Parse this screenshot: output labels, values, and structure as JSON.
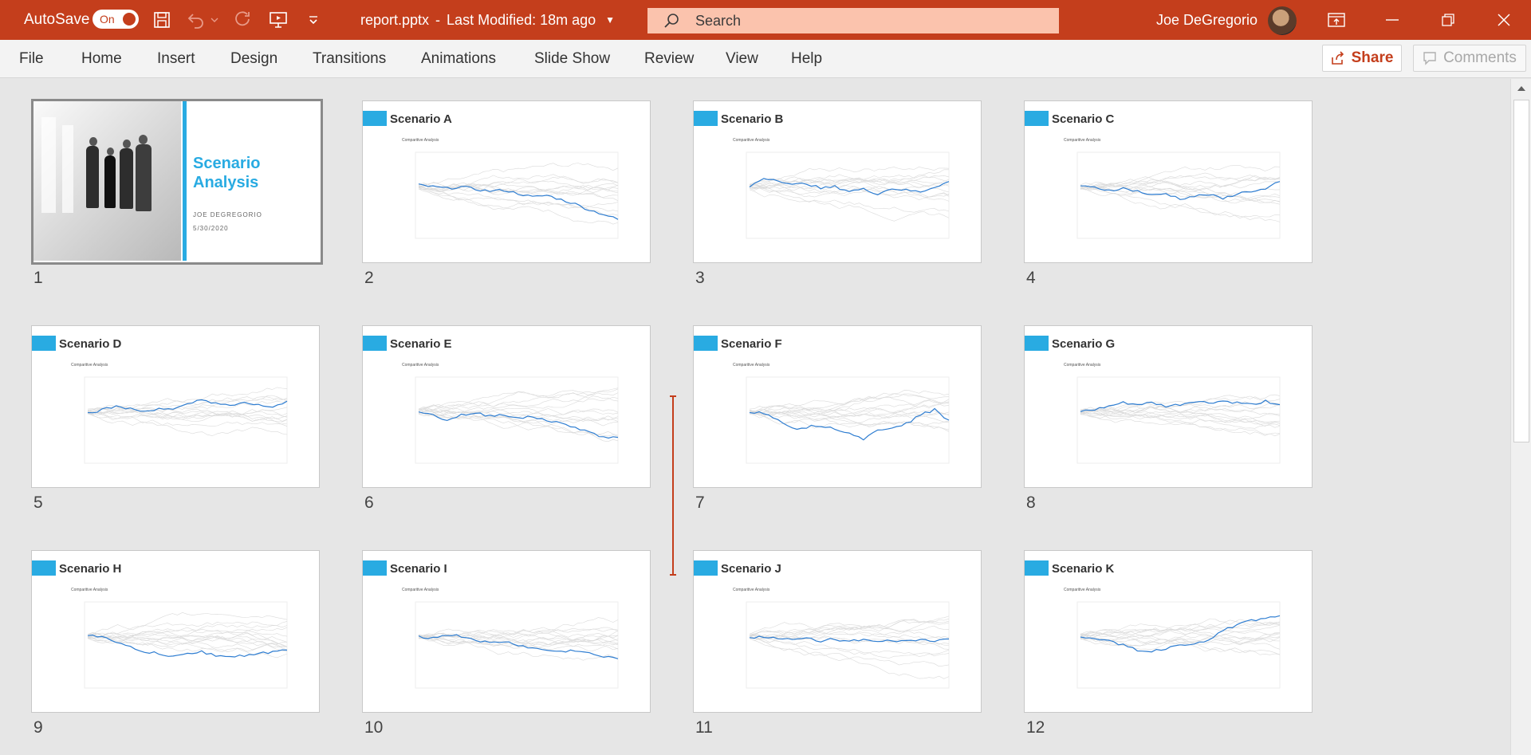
{
  "titlebar": {
    "autosave_label": "AutoSave",
    "autosave_state": "On",
    "filename": "report.pptx",
    "separator": "-",
    "modified": "Last Modified: 18m ago",
    "search_placeholder": "Search",
    "user_name": "Joe DeGregorio"
  },
  "ribbon": {
    "tabs": [
      "File",
      "Home",
      "Insert",
      "Design",
      "Transitions",
      "Animations",
      "Slide Show",
      "Review",
      "View",
      "Help"
    ],
    "share_label": "Share",
    "comments_label": "Comments"
  },
  "title_slide": {
    "title_line1": "Scenario",
    "title_line2": "Analysis",
    "author": "JOE DEGREGORIO",
    "date": "5/30/2020",
    "number": "1"
  },
  "slides": [
    {
      "number": "2",
      "title": "Scenario A",
      "chart_subtitle": "Comparitive Analysis",
      "trend": [
        0.62,
        0.6,
        0.58,
        0.6,
        0.57,
        0.55,
        0.56,
        0.52,
        0.48,
        0.5,
        0.45,
        0.4,
        0.33,
        0.28,
        0.22
      ]
    },
    {
      "number": "3",
      "title": "Scenario B",
      "chart_subtitle": "Comparitive Analysis",
      "trend": [
        0.6,
        0.7,
        0.68,
        0.62,
        0.64,
        0.58,
        0.6,
        0.55,
        0.57,
        0.52,
        0.58,
        0.56,
        0.54,
        0.6,
        0.66
      ]
    },
    {
      "number": "4",
      "title": "Scenario C",
      "chart_subtitle": "Comparitive Analysis",
      "trend": [
        0.6,
        0.59,
        0.56,
        0.58,
        0.55,
        0.5,
        0.52,
        0.46,
        0.49,
        0.51,
        0.46,
        0.52,
        0.55,
        0.57,
        0.66
      ]
    },
    {
      "number": "5",
      "title": "Scenario D",
      "chart_subtitle": "Comparitive Analysis",
      "trend": [
        0.58,
        0.62,
        0.66,
        0.63,
        0.6,
        0.64,
        0.62,
        0.68,
        0.74,
        0.7,
        0.66,
        0.7,
        0.68,
        0.64,
        0.72
      ]
    },
    {
      "number": "6",
      "title": "Scenario E",
      "chart_subtitle": "Comparitive Analysis",
      "trend": [
        0.6,
        0.56,
        0.5,
        0.56,
        0.58,
        0.55,
        0.57,
        0.52,
        0.54,
        0.5,
        0.46,
        0.42,
        0.36,
        0.3,
        0.3
      ]
    },
    {
      "number": "7",
      "title": "Scenario F",
      "chart_subtitle": "Comparitive Analysis",
      "trend": [
        0.6,
        0.58,
        0.52,
        0.4,
        0.42,
        0.44,
        0.4,
        0.36,
        0.28,
        0.38,
        0.42,
        0.46,
        0.56,
        0.62,
        0.5
      ]
    },
    {
      "number": "8",
      "title": "Scenario G",
      "chart_subtitle": "Comparitive Analysis",
      "trend": [
        0.6,
        0.62,
        0.66,
        0.7,
        0.68,
        0.7,
        0.66,
        0.68,
        0.72,
        0.7,
        0.72,
        0.7,
        0.68,
        0.72,
        0.68
      ]
    },
    {
      "number": "9",
      "title": "Scenario H",
      "chart_subtitle": "Comparitive Analysis",
      "trend": [
        0.62,
        0.6,
        0.52,
        0.48,
        0.42,
        0.4,
        0.36,
        0.4,
        0.42,
        0.38,
        0.36,
        0.38,
        0.4,
        0.42,
        0.44
      ]
    },
    {
      "number": "10",
      "title": "Scenario I",
      "chart_subtitle": "Comparitive Analysis",
      "trend": [
        0.6,
        0.58,
        0.62,
        0.6,
        0.56,
        0.52,
        0.54,
        0.5,
        0.46,
        0.44,
        0.42,
        0.44,
        0.4,
        0.36,
        0.34
      ]
    },
    {
      "number": "11",
      "title": "Scenario J",
      "chart_subtitle": "Comparitive Analysis",
      "trend": [
        0.58,
        0.6,
        0.57,
        0.56,
        0.58,
        0.55,
        0.57,
        0.54,
        0.56,
        0.53,
        0.55,
        0.54,
        0.56,
        0.55,
        0.57
      ]
    },
    {
      "number": "12",
      "title": "Scenario K",
      "chart_subtitle": "Comparitive Analysis",
      "trend": [
        0.6,
        0.58,
        0.54,
        0.5,
        0.44,
        0.42,
        0.46,
        0.5,
        0.52,
        0.56,
        0.66,
        0.74,
        0.78,
        0.8,
        0.84
      ]
    }
  ],
  "colors": {
    "accent_red": "#c43e1c",
    "slide_blue": "#29abe2",
    "trend_line": "#2e7dd1",
    "background_lines": "#dadada"
  },
  "icons": {
    "save": "save-icon",
    "undo": "undo-icon",
    "redo": "redo-icon",
    "present": "present-from-start-icon",
    "customize": "customize-qat-icon",
    "search": "search-icon",
    "ribbon_display": "ribbon-display-icon",
    "minimize": "minimize-icon",
    "restore": "restore-icon",
    "close": "close-icon"
  }
}
